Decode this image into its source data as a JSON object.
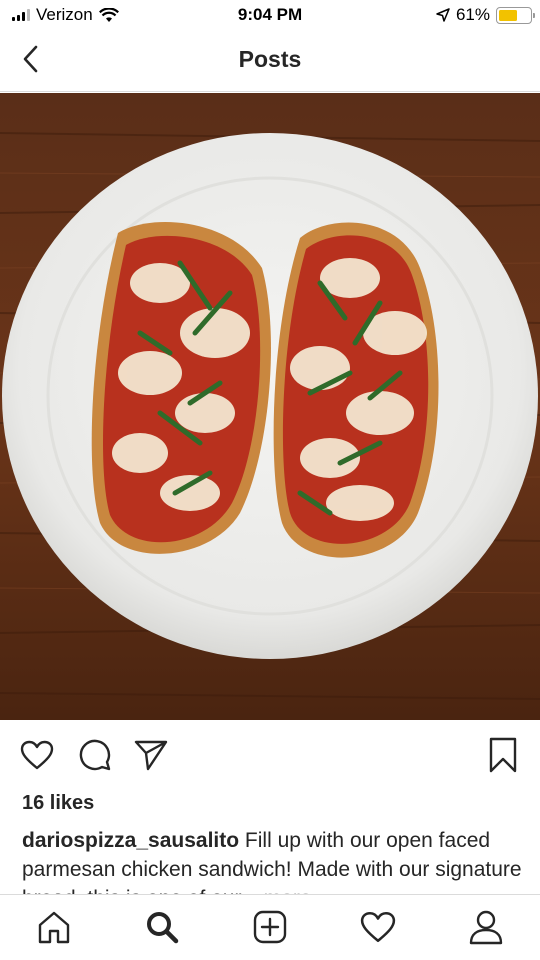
{
  "status_bar": {
    "carrier": "Verizon",
    "time": "9:04 PM",
    "battery_percent": "61%",
    "battery_level": 0.61,
    "battery_color": "#f2c200"
  },
  "header": {
    "title": "Posts",
    "back_icon": "chevron-left-icon"
  },
  "post": {
    "image_description_icon": "photo",
    "actions": [
      "heart-icon",
      "comment-icon",
      "share-icon",
      "bookmark-icon"
    ],
    "likes": "16 likes",
    "username": "dariospizza_sausalito",
    "caption_text": " Fill up with our open faced parmesan chicken sandwich! Made with our signature bread, this is one of our...",
    "more_label": " more"
  },
  "tab_bar": {
    "tabs": [
      "home-icon",
      "search-icon",
      "new-post-icon",
      "activity-icon",
      "profile-icon"
    ]
  }
}
